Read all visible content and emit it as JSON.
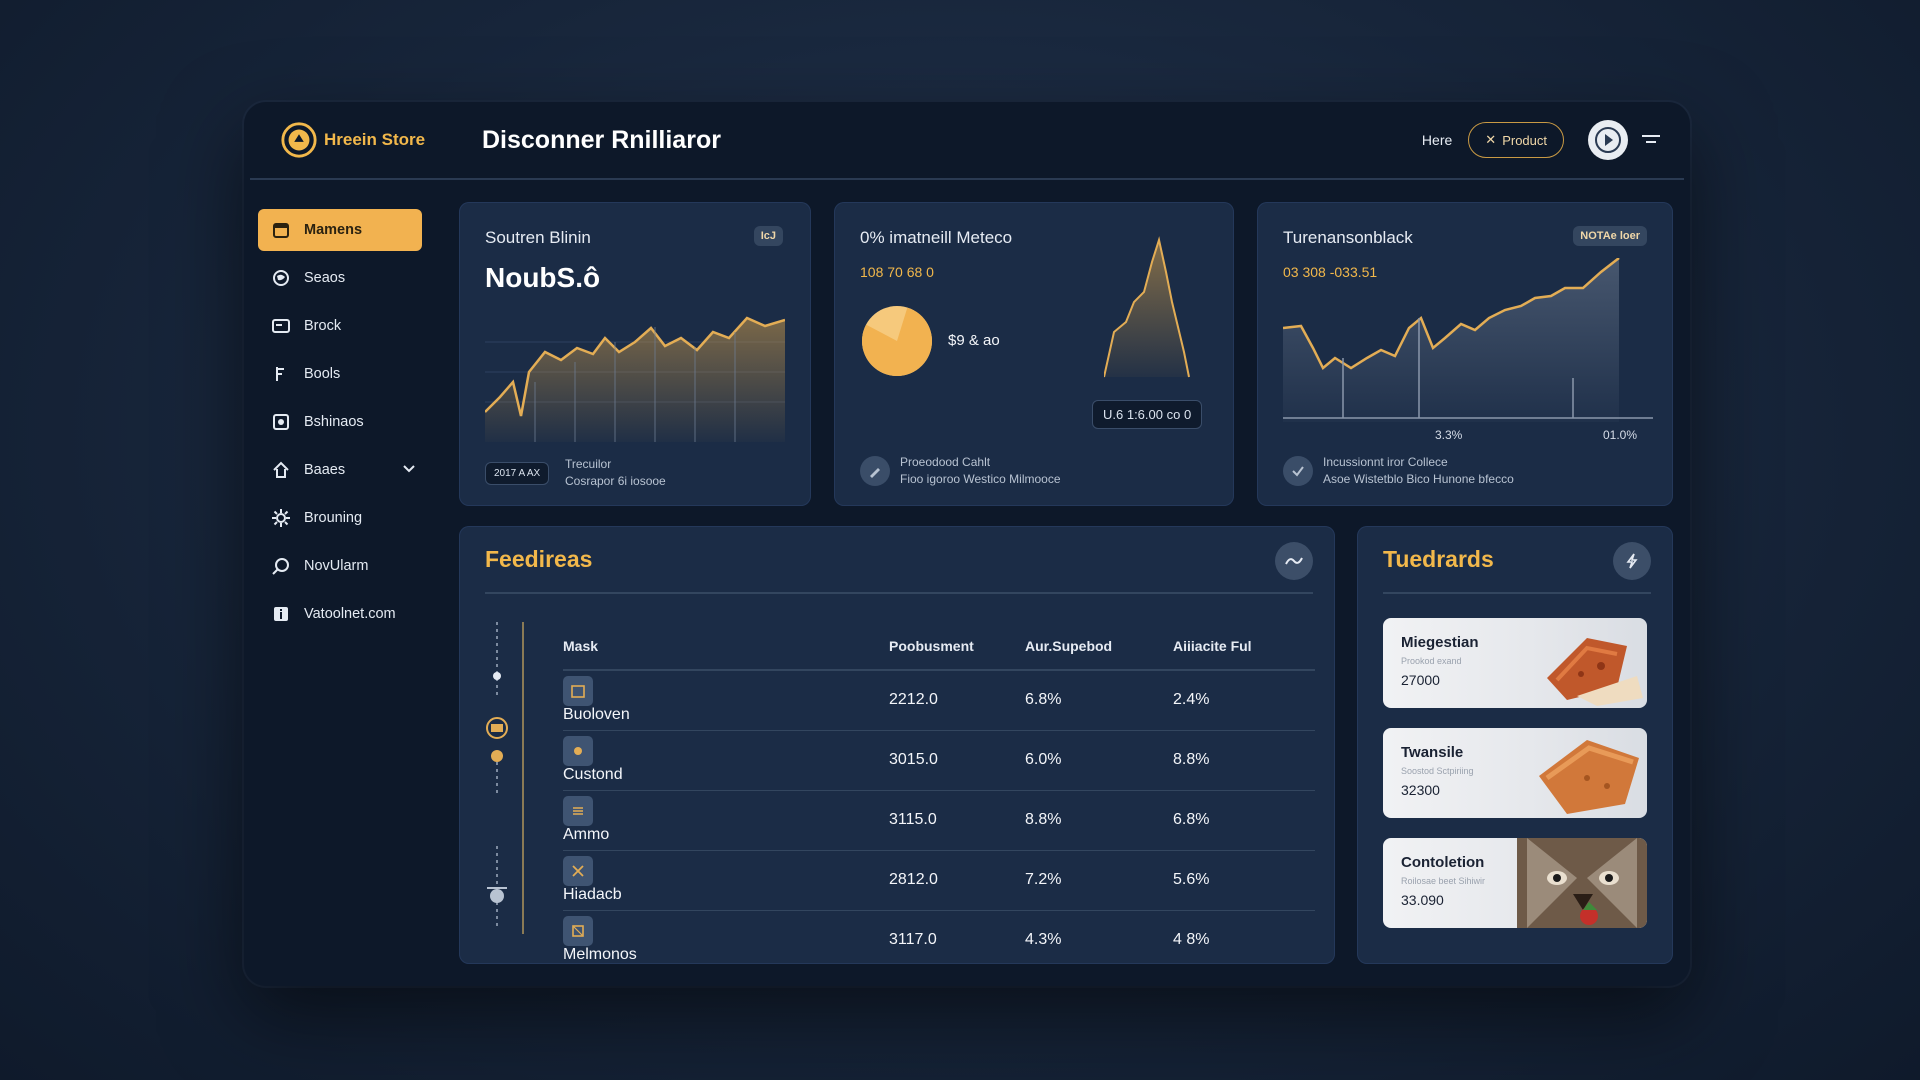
{
  "header": {
    "brand": "Hreein Store",
    "title": "Disconner Rnilliaror",
    "link_here": "Here",
    "product_button": "Product"
  },
  "sidebar": {
    "items": [
      {
        "label": "Mamens",
        "icon": "calendar-icon",
        "active": true
      },
      {
        "label": "Seaos",
        "icon": "globe-icon"
      },
      {
        "label": "Brock",
        "icon": "card-icon"
      },
      {
        "label": "Bools",
        "icon": "tool-icon"
      },
      {
        "label": "Bshinaos",
        "icon": "camera-icon"
      },
      {
        "label": "Baaes",
        "icon": "home-icon",
        "expandable": true
      },
      {
        "label": "Brouning",
        "icon": "gear-icon"
      },
      {
        "label": "NovUlarm",
        "icon": "search-icon"
      },
      {
        "label": "Vatoolnet.com",
        "icon": "info-icon"
      }
    ]
  },
  "cards": {
    "card1": {
      "title": "Soutren Blinin",
      "value": "NoubS.ô",
      "badge": "IcJ",
      "chip": "2017 A AX",
      "foot_line1": "Trecuilor",
      "foot_line2": "Cosrapor 6i iosooe"
    },
    "card2": {
      "title": "0% imatneill Meteco",
      "sub": "108 70 68 0",
      "pie_label": "$9 & ao",
      "chip": "U.6 1:6.00 co 0",
      "foot_line1": "Proeodood  Cahlt",
      "foot_line2": "Fioo igoroo Westico Milmooce",
      "pie_fraction": 0.78
    },
    "card3": {
      "title": "Turenansonblack",
      "sub": "03 308 -033.51",
      "badge": "NOTAe loer",
      "x_label_1": "3.3%",
      "x_label_2": "01.0%",
      "foot_line1": "Incussionnt iror  Collece",
      "foot_line2": "Asoe Wistetblo  Bico  Hunone bfecco"
    }
  },
  "feed": {
    "title": "Feedireas",
    "columns": [
      "Mask",
      "Poobusment",
      "Aur.Supebod",
      "Aiiiacite Ful"
    ],
    "rows": [
      {
        "name": "Buoloven",
        "v1": "2212.0",
        "v2": "6.8%",
        "v3": "2.4%"
      },
      {
        "name": "Custond",
        "v1": "3015.0",
        "v2": "6.0%",
        "v3": "8.8%"
      },
      {
        "name": "Ammo",
        "v1": "3115.0",
        "v2": "8.8%",
        "v3": "6.8%"
      },
      {
        "name": "Hiadacb",
        "v1": "2812.0",
        "v2": "7.2%",
        "v3": "5.6%"
      },
      {
        "name": "Melmonos",
        "v1": "3117.0",
        "v2": "4.3%",
        "v3": "4 8%"
      }
    ]
  },
  "trends": {
    "title": "Tuedrards",
    "items": [
      {
        "name": "Miegestian",
        "desc": "Prookod exand",
        "price": "27000"
      },
      {
        "name": "Twansile",
        "desc": "Soostod Sctpiriing",
        "price": "32300"
      },
      {
        "name": "Contoletion",
        "desc": "Roilosae beet Sihiwir",
        "price": "33.090"
      }
    ]
  },
  "colors": {
    "accent": "#f2b84b",
    "panel": "#1b2c46",
    "app_bg": "#0d1829"
  }
}
